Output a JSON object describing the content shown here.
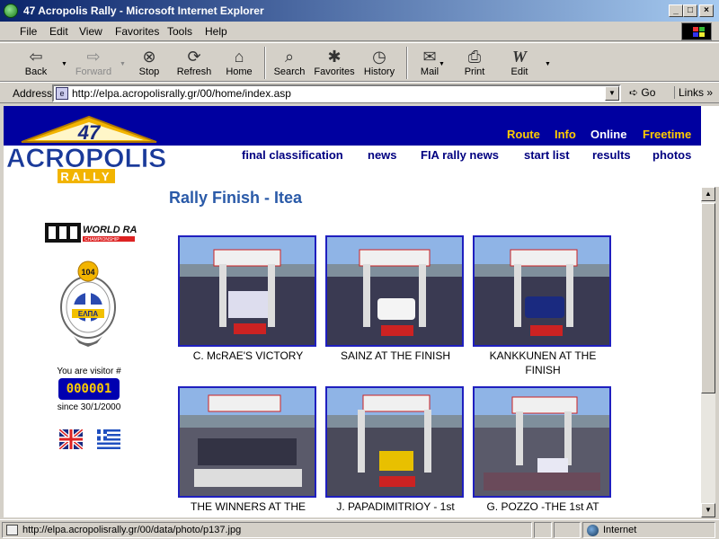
{
  "window": {
    "title": "47 Acropolis Rally - Microsoft Internet Explorer",
    "min": "_",
    "max": "□",
    "close": "×"
  },
  "menu": [
    "File",
    "Edit",
    "View",
    "Favorites",
    "Tools",
    "Help"
  ],
  "toolbar": {
    "back": "Back",
    "forward": "Forward",
    "stop": "Stop",
    "refresh": "Refresh",
    "home": "Home",
    "search": "Search",
    "favorites": "Favorites",
    "history": "History",
    "mail": "Mail",
    "print": "Print",
    "edit": "Edit"
  },
  "address": {
    "label": "Address",
    "url": "http://elpa.acropolisrally.gr/00/home/index.asp",
    "go": "Go",
    "links": "Links »"
  },
  "site": {
    "logo_number": "47",
    "logo_name": "ACROPOLIS",
    "logo_sub": "RALLY",
    "top_nav": [
      {
        "label": "Route",
        "color": "#ffcc00"
      },
      {
        "label": "Info",
        "color": "#ffcc00"
      },
      {
        "label": "Online",
        "color": "#ffffff"
      },
      {
        "label": "Freetime",
        "color": "#ffcc00"
      }
    ],
    "main_nav": [
      "final classification",
      "news",
      "FIA rally news",
      "start list",
      "results",
      "photos"
    ],
    "heading": "Rally Finish - Itea",
    "wrc_text": "WORLD RALLY",
    "wrc_sub": "CHAMPIONSHIP",
    "emblem_number": "104",
    "emblem_text": "ΕΛΠΑ",
    "visitor_label": "You are visitor #",
    "visitor_count": "000001",
    "since": "since 30/1/2000",
    "photos": [
      {
        "caption": "C. McRAE'S VICTORY"
      },
      {
        "caption": "SAINZ AT THE FINISH"
      },
      {
        "caption": "KANKKUNEN AT THE FINISH"
      },
      {
        "caption": "THE WINNERS AT THE"
      },
      {
        "caption": "J. PAPADIMITRIOY - 1st"
      },
      {
        "caption": "G. POZZO -THE 1st AT"
      }
    ]
  },
  "status": {
    "url": "http://elpa.acropolisrally.gr/00/data/photo/p137.jpg",
    "zone": "Internet"
  },
  "colors": {
    "band": "#0000a0",
    "heading": "#2a5aa8",
    "nav": "#000080",
    "accent": "#ffcc00"
  }
}
